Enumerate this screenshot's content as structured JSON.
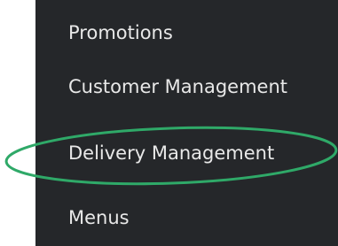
{
  "sidebar": {
    "items": [
      {
        "label": "Promotions"
      },
      {
        "label": "Customer Management"
      },
      {
        "label": "Delivery Management"
      },
      {
        "label": "Menus"
      }
    ]
  },
  "annotation": {
    "shape": "ellipse",
    "target": "Delivery Management",
    "color": "#2fa968"
  }
}
